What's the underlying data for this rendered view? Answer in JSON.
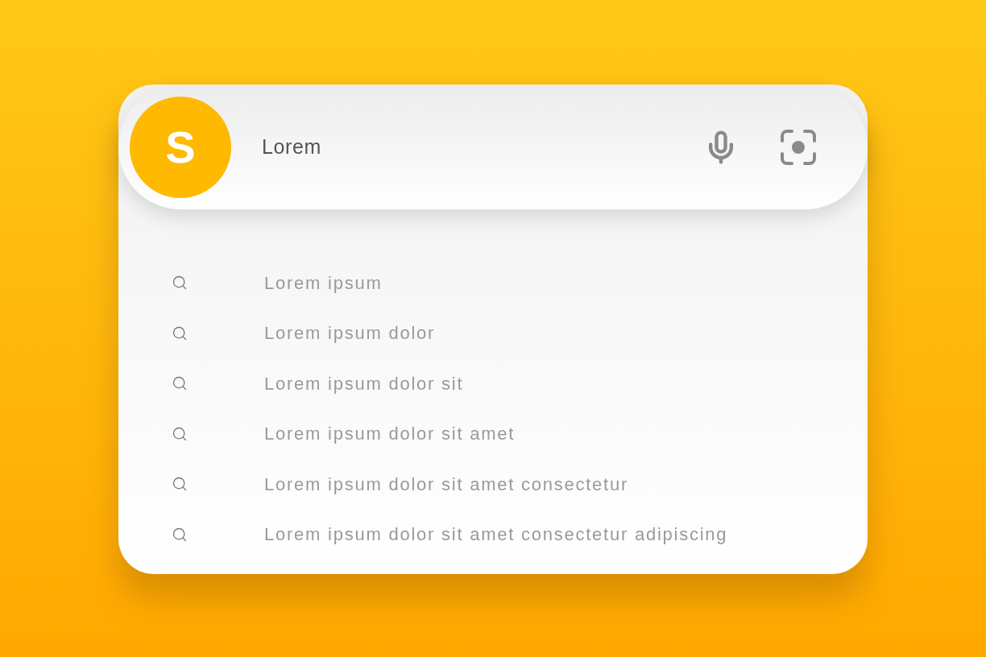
{
  "search": {
    "logo": "S",
    "value": "Lorem"
  },
  "suggestions": [
    {
      "text": "Lorem ipsum"
    },
    {
      "text": "Lorem ipsum dolor"
    },
    {
      "text": "Lorem ipsum dolor sit"
    },
    {
      "text": "Lorem ipsum dolor sit amet"
    },
    {
      "text": "Lorem ipsum dolor sit amet consectetur"
    },
    {
      "text": "Lorem ipsum dolor sit amet consectetur adipiscing"
    }
  ]
}
